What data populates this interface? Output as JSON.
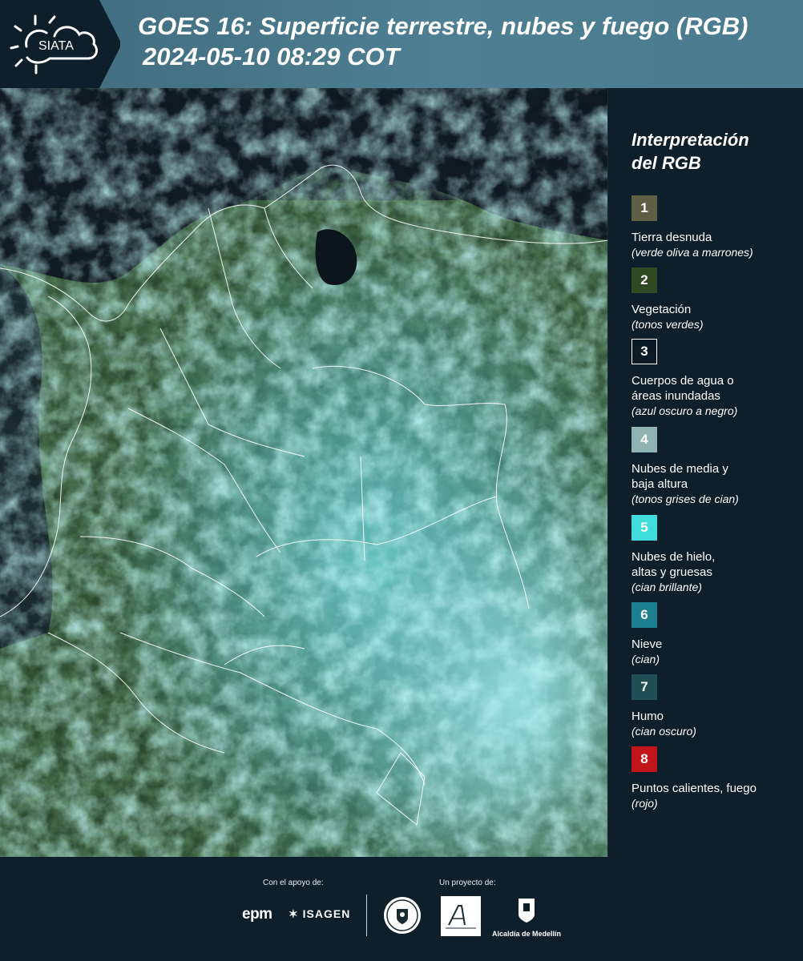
{
  "header": {
    "logo_text": "SIATA",
    "title_line1": "GOES 16: Superficie terrestre, nubes y fuego (RGB)",
    "title_line2": "2024-05-10 08:29 COT"
  },
  "legend": {
    "title_line1": "Interpretación",
    "title_line2": "del RGB",
    "items": [
      {
        "number": "1",
        "color": "#5e5e45",
        "label": "Tierra desnuda",
        "note": "(verde oliva a marrones)"
      },
      {
        "number": "2",
        "color": "#2f4a22",
        "label": "Vegetación",
        "note": "(tonos verdes)"
      },
      {
        "number": "3",
        "color": "#0b1a24",
        "label": "Cuerpos de agua o",
        "label2": "áreas inundadas",
        "note": "(azul oscuro a negro)"
      },
      {
        "number": "4",
        "color": "#8fb3b3",
        "label": "Nubes de media y",
        "label2": "baja altura",
        "note": "(tonos grises de cian)"
      },
      {
        "number": "5",
        "color": "#3fdcdc",
        "label": "Nubes de hielo,",
        "label2": "altas y gruesas",
        "note": "(cian brillante)"
      },
      {
        "number": "6",
        "color": "#1d7f91",
        "label": "Nieve",
        "note": "(cian)"
      },
      {
        "number": "7",
        "color": "#1f4f52",
        "label": "Humo",
        "note": "(cian oscuro)"
      },
      {
        "number": "8",
        "color": "#c0161a",
        "label": "Puntos calientes, fuego",
        "note": "(rojo)"
      }
    ]
  },
  "footer": {
    "support_label": "Con el apoyo de:",
    "project_label": "Un proyecto de:",
    "epm": "epm",
    "isagen": "ISAGEN",
    "alcaldia": "Alcaldía de Medellín"
  }
}
